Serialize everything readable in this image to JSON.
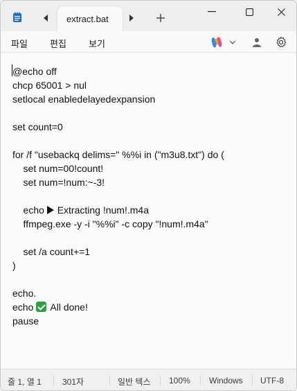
{
  "tab": {
    "title": "extract.bat"
  },
  "menu": {
    "file": "파일",
    "edit": "편집",
    "view": "보기"
  },
  "editor": {
    "lines": [
      "@echo off",
      "chcp 65001 > nul",
      "setlocal enabledelayedexpansion",
      "",
      "set count=0",
      "",
      "for /f \"usebackq delims=\" %%i in (\"m3u8.txt\") do (",
      "    set num=00!count!",
      "    set num=!num:~-3!",
      "",
      "    echo ",
      "    ffmpeg.exe -y -i \"%%i\" -c copy \"!num!.m4a\"",
      "",
      "    set /a count+=1",
      ")",
      "",
      "echo.",
      "echo ",
      "pause"
    ],
    "echo_extract_text": "Extracting !num!.m4a",
    "echo_done_text": "All done!"
  },
  "status": {
    "position": "줄 1, 열 1",
    "chars": "301자",
    "format": "일반 텍스",
    "zoom": "100%",
    "line_ending": "Windows",
    "encoding": "UTF-8"
  },
  "colors": {
    "accent_check": "#2ea043",
    "app_icon": "#1f6fc5"
  }
}
